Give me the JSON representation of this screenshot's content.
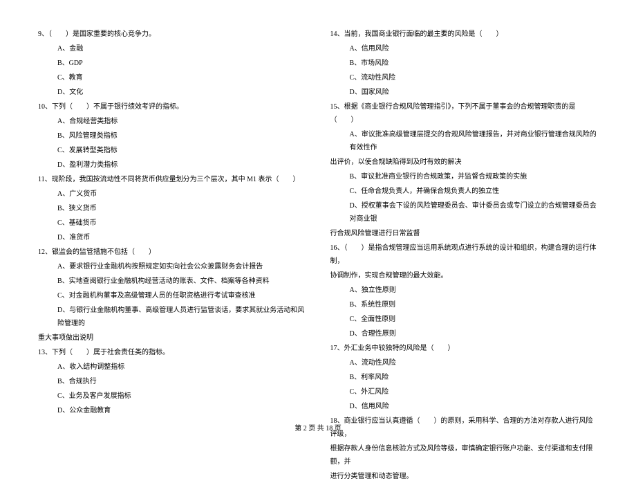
{
  "left": {
    "q9": {
      "stem": "9、（　　）是国家重要的核心竞争力。",
      "a": "A、金融",
      "b": "B、GDP",
      "c": "C、教育",
      "d": "D、文化"
    },
    "q10": {
      "stem": "10、下列（　　）不属于银行绩效考评的指标。",
      "a": "A、合规经营类指标",
      "b": "B、风险管理类指标",
      "c": "C、发展转型类指标",
      "d": "D、盈利潜力类指标"
    },
    "q11": {
      "stem": "11、现阶段，我国按流动性不同将货币供应量划分为三个层次，其中 M1 表示（　　）",
      "a": "A、广义货币",
      "b": "B、狭义货币",
      "c": "C、基础货币",
      "d": "D、准货币"
    },
    "q12": {
      "stem": "12、银监会的监管措施不包括（　　）",
      "a": "A、要求银行业金融机构按照规定如实向社会公众披露财务会计报告",
      "b": "B、实地查阅银行业金融机构经营活动的账表、文件、档案等各种资料",
      "c": "C、对金融机构董事及高级管理人员的任职资格进行考试审查核准",
      "d": "D、与银行业金融机构董事、高级管理人员进行监管谈话，要求其就业务活动和风险管理的",
      "d_cont": "重大事项做出说明"
    },
    "q13": {
      "stem": "13、下列（　　）属于社会责任类的指标。",
      "a": "A、收入结构调整指标",
      "b": "B、合规执行",
      "c": "C、业务及客户发展指标",
      "d": "D、公众金融教育"
    }
  },
  "right": {
    "q14": {
      "stem": "14、当前，我国商业银行面临的最主要的风险是（　　）",
      "a": "A、信用风险",
      "b": "B、市场风险",
      "c": "C、流动性风险",
      "d": "D、国家风险"
    },
    "q15": {
      "stem": "15、根据《商业银行合规风险管理指引》，下列不属于董事会的合规管理职责的是（　　）",
      "a": "A、审议批准高级管理层提交的合规风险管理报告，并对商业银行管理合规风险的有效性作",
      "a_cont": "出评价，以使合规缺陷得到及时有效的解决",
      "b": "B、审议批准商业银行的合规政策，并监督合规政策的实施",
      "c": "C、任命合规负责人，并确保合规负责人的独立性",
      "d": "D、授权董事会下设的风险管理委员会、审计委员会或专门设立的合规管理委员会对商业银",
      "d_cont": "行合规风险管理进行日常监督"
    },
    "q16": {
      "stem": "16、（　　）是指合规管理应当运用系统观点进行系统的设计和组织，构建合理的运行体制，",
      "stem_cont": "协调制作，实现合规管理的最大效能。",
      "a": "A、独立性原则",
      "b": "B、系统性原则",
      "c": "C、全面性原则",
      "d": "D、合理性原则"
    },
    "q17": {
      "stem": "17、外汇业务中较独特的风险是（　　）",
      "a": "A、流动性风险",
      "b": "B、利率风险",
      "c": "C、外汇风险",
      "d": "D、信用风险"
    },
    "q18": {
      "stem": "18、商业银行应当认真遵循（　　）的原则，采用科学、合理的方法对存款人进行风险评级，",
      "stem_cont1": "根据存款人身份信息核验方式及风险等级，审慎确定银行账户功能、支付渠道和支付限额，并",
      "stem_cont2": "进行分类管理和动态管理。"
    }
  },
  "footer": "第 2 页 共 18 页"
}
